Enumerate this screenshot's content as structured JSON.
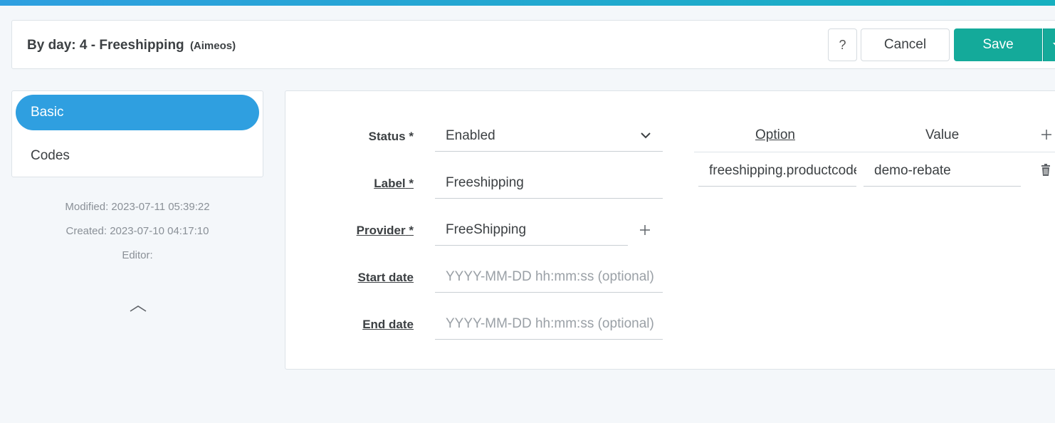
{
  "header": {
    "title": "By day: 4 - Freeshipping",
    "site": "(Aimeos)",
    "help_label": "?",
    "cancel_label": "Cancel",
    "save_label": "Save"
  },
  "sidebar": {
    "items": [
      {
        "label": "Basic",
        "active": true
      },
      {
        "label": "Codes",
        "active": false
      }
    ],
    "modified": "Modified: 2023-07-11 05:39:22",
    "created": "Created: 2023-07-10 04:17:10",
    "editor": "Editor:"
  },
  "form": {
    "status_label": "Status",
    "status_value": "Enabled",
    "label_label": "Label",
    "label_value": "Freeshipping",
    "provider_label": "Provider",
    "provider_value": "FreeShipping",
    "start_label": "Start date",
    "start_placeholder": "YYYY-MM-DD hh:mm:ss (optional)",
    "end_label": "End date",
    "end_placeholder": "YYYY-MM-DD hh:mm:ss (optional)",
    "required_marker": "*"
  },
  "options": {
    "col_option": "Option",
    "col_value": "Value",
    "rows": [
      {
        "option": "freeshipping.productcode",
        "value": "demo-rebate"
      }
    ]
  },
  "colors": {
    "accent": "#2f9fe0",
    "save": "#14aa9a"
  },
  "icons": {
    "help": "question-mark",
    "dropdown": "chevron-down-icon",
    "add": "plus-icon",
    "delete": "trash-icon",
    "collapse": "chevron-up-icon"
  }
}
